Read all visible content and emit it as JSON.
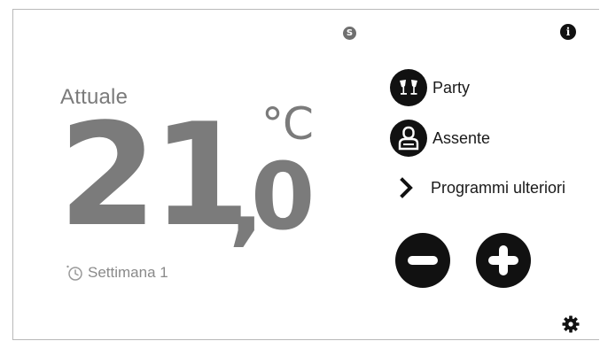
{
  "header": {
    "mode_badge": "S",
    "info_icon": "i"
  },
  "current": {
    "label": "Attuale",
    "temp_integer": "21",
    "temp_separator": ",",
    "temp_decimal": "0",
    "unit": "°C"
  },
  "schedule": {
    "icon": "clock-icon",
    "label": "Settimana 1"
  },
  "programs": {
    "party_label": "Party",
    "absent_label": "Assente",
    "more_label": "Programmi ulteriori"
  },
  "controls": {
    "decrease_icon": "minus-icon",
    "increase_icon": "plus-icon",
    "settings_icon": "gear-icon"
  },
  "colors": {
    "dark": "#111111",
    "temp_gray": "#7b7b7b",
    "background": "#ffffff"
  }
}
